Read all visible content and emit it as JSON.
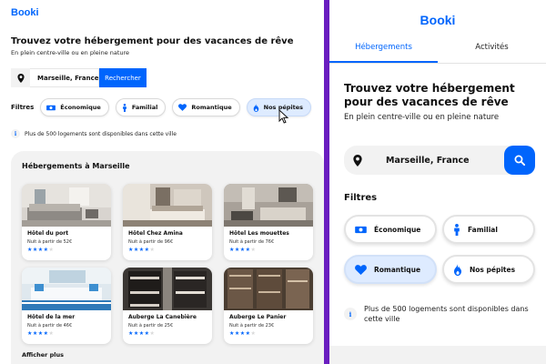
{
  "brand": {
    "logo": "Booki",
    "accent": "#0065fc",
    "divider": "#6a1ec0"
  },
  "desktop": {
    "heading": "Trouvez votre hébergement pour des vacances de rêve",
    "subheading": "En plein centre-ville ou en pleine nature",
    "search": {
      "icon": "location-pin-icon",
      "value": "Marseille, France",
      "button": "Rechercher"
    },
    "filters_label": "Filtres",
    "filters": [
      {
        "label": "Économique",
        "icon": "money-icon",
        "active": false
      },
      {
        "label": "Familial",
        "icon": "person-icon",
        "active": false
      },
      {
        "label": "Romantique",
        "icon": "heart-icon",
        "active": false
      },
      {
        "label": "Nos pépites",
        "icon": "fire-icon",
        "active": true
      }
    ],
    "info": "Plus de 500 logements sont disponibles dans cette ville",
    "section_title": "Hébergements à Marseille",
    "cards": [
      {
        "name": "Hôtel du port",
        "price": "Nuit à partir de 52€",
        "rating": 4
      },
      {
        "name": "Hôtel Chez Amina",
        "price": "Nuit à partir de 96€",
        "rating": 4
      },
      {
        "name": "Hôtel Les mouettes",
        "price": "Nuit à partir de 76€",
        "rating": 4
      },
      {
        "name": "Hôtel de la mer",
        "price": "Nuit à partir de 46€",
        "rating": 4
      },
      {
        "name": "Auberge La Canebière",
        "price": "Nuit à partir de 25€",
        "rating": 4
      },
      {
        "name": "Auberge Le Panier",
        "price": "Nuit à partir de 23€",
        "rating": 4
      }
    ],
    "more": "Afficher plus"
  },
  "mobile": {
    "tabs": [
      {
        "label": "Hébergements",
        "active": true
      },
      {
        "label": "Activités",
        "active": false
      }
    ],
    "heading": "Trouvez votre hébergement pour des vacances de rêve",
    "subheading": "En plein centre-ville ou en pleine nature",
    "search": {
      "icon": "location-pin-icon",
      "value": "Marseille, France",
      "button_icon": "search-icon"
    },
    "filters_label": "Filtres",
    "filters": [
      {
        "label": "Économique",
        "icon": "money-icon",
        "active": false
      },
      {
        "label": "Familial",
        "icon": "person-icon",
        "active": false
      },
      {
        "label": "Romantique",
        "icon": "heart-icon",
        "active": true
      },
      {
        "label": "Nos pépites",
        "icon": "fire-icon",
        "active": false
      }
    ],
    "info": "Plus de 500 logements sont disponibles dans cette ville"
  }
}
